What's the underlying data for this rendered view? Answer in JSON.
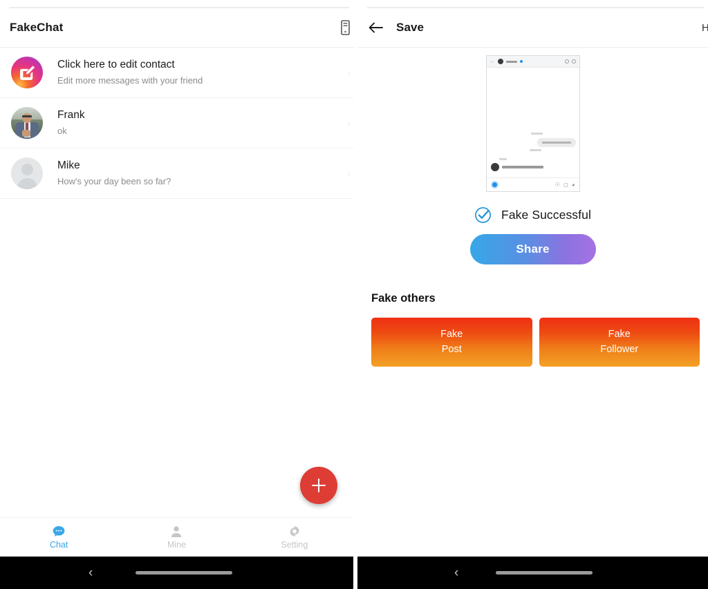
{
  "left_panel": {
    "appbar": {
      "title": "FakeChat",
      "device_icon": "device-phone-icon"
    },
    "chat_rows": [
      {
        "name": "Click here to edit contact",
        "subtitle": "Edit more messages with your friend",
        "avatar": "edit-contact-gradient-icon",
        "chevron": "›"
      },
      {
        "name": "Frank",
        "subtitle": "ok",
        "avatar": "photo-avatar",
        "chevron": "›"
      },
      {
        "name": "Mike",
        "subtitle": "How's your day been so far?",
        "avatar": "default-person-avatar",
        "chevron": "›"
      }
    ],
    "fab": {
      "label": "+",
      "color": "#dd3d35"
    },
    "tabs": [
      {
        "label": "Chat",
        "icon": "chat-bubble-icon",
        "active": true
      },
      {
        "label": "Mine",
        "icon": "person-icon",
        "active": false
      },
      {
        "label": "Setting",
        "icon": "gear-icon",
        "active": false
      }
    ],
    "sysnav": {
      "back": "‹",
      "home_pill": ""
    }
  },
  "right_panel": {
    "appbar": {
      "back_icon": "back-arrow-icon",
      "title": "Save",
      "home_label": "Ho"
    },
    "preview": {
      "alt": "chat-screenshot-preview"
    },
    "success": {
      "icon": "check-circle-icon",
      "text": "Fake Successful",
      "icon_color": "#2196d8"
    },
    "share_button": {
      "label": "Share",
      "gradient_from": "#35a8e8",
      "gradient_to": "#a672e2"
    },
    "others": {
      "title": "Fake others",
      "cards": [
        {
          "line1": "Fake",
          "line2": "Post"
        },
        {
          "line1": "Fake",
          "line2": "Follower"
        }
      ],
      "gradient_from": "#f03015",
      "gradient_to": "#f4a127"
    },
    "sysnav": {
      "back": "‹",
      "home_pill": ""
    }
  }
}
